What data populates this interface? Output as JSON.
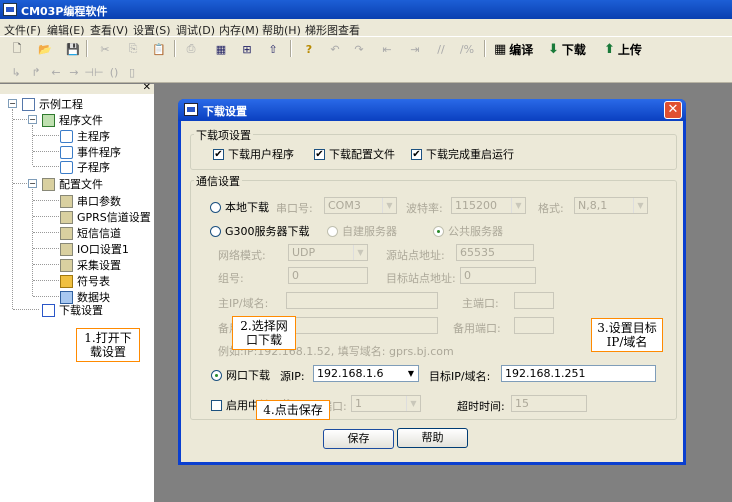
{
  "app": {
    "title": "CM03P编程软件"
  },
  "menu": [
    "文件(F)",
    "编辑(E)",
    "查看(V)",
    "设置(S)",
    "调试(D)",
    "内存(M)",
    "帮助(H)",
    "梯形图查看"
  ],
  "toolbar": {
    "compile_label": "编译",
    "download_label": "下载",
    "upload_label": "上传"
  },
  "tree": {
    "root": "示例工程",
    "program_files": "程序文件",
    "programs": [
      "主程序",
      "事件程序",
      "子程序"
    ],
    "config_files": "配置文件",
    "configs": [
      "串口参数",
      "GPRS信道设置",
      "短信信道",
      "IO口设置1",
      "采集设置",
      "符号表",
      "数据块"
    ],
    "download_settings": "下载设置"
  },
  "dialog": {
    "title": "下载设置",
    "download_items": {
      "legend": "下载项设置",
      "download_user_program": "下载用户程序",
      "download_config_file": "下载配置文件",
      "restart_after_download": "下载完成重启运行"
    },
    "comm": {
      "legend": "通信设置",
      "local_download": "本地下载",
      "serial_port_label": "串口号:",
      "serial_port_value": "COM3",
      "baud_rate_label": "波特率:",
      "baud_rate_value": "115200",
      "format_label": "格式:",
      "format_value": "N,8,1",
      "g300_download": "G300服务器下载",
      "auto_server": "自建服务器",
      "public_server": "公共服务器",
      "network_mode_label": "网络模式:",
      "network_mode_value": "UDP",
      "source_addr_label": "源站点地址:",
      "source_addr_value": "65535",
      "group_label": "组号:",
      "group_value": "0",
      "target_addr_label": "目标站点地址:",
      "target_addr_value": "0",
      "main_ip_label": "主IP/域名:",
      "main_port_label": "主端口:",
      "backup_ip_label": "备用IP/域名:",
      "backup_port_label": "备用端口:",
      "example": "例如:IP:192.168.1.52, 填写域名: gprs.bj.com",
      "lan_download": "网口下载",
      "source_ip_label": "源IP:",
      "source_ip_value": "192.168.1.6",
      "target_ip_label": "目标IP/域名:",
      "target_ip_value": "192.168.1.251",
      "enable_relay": "启用中转下载",
      "relay_port_label": "中转端口:",
      "relay_port_value": "1",
      "timeout_label": "超时时间:",
      "timeout_value": "15"
    },
    "save_label": "保存",
    "help_label": "帮助"
  },
  "callouts": {
    "step1": "1.打开下载设置",
    "step2": "2.选择网口下载",
    "step3": "3.设置目标IP/域名",
    "step4": "4.点击保存"
  }
}
